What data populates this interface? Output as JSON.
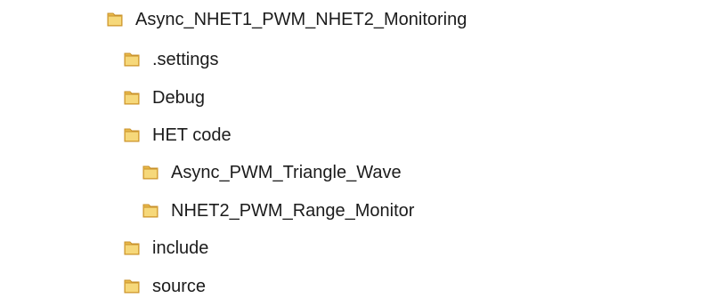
{
  "tree": {
    "root": {
      "label": "Async_NHET1_PWM_NHET2_Monitoring",
      "icon": "folder-icon"
    },
    "children": [
      {
        "label": ".settings",
        "icon": "folder-icon"
      },
      {
        "label": "Debug",
        "icon": "folder-icon"
      },
      {
        "label": "HET code",
        "icon": "folder-icon"
      },
      {
        "label": "Async_PWM_Triangle_Wave",
        "icon": "folder-icon"
      },
      {
        "label": "NHET2_PWM_Range_Monitor",
        "icon": "folder-icon"
      },
      {
        "label": "include",
        "icon": "folder-icon"
      },
      {
        "label": "source",
        "icon": "folder-icon"
      }
    ]
  },
  "colors": {
    "folder_light": "#f6d87a",
    "folder_mid": "#e9b94a",
    "folder_dark": "#c8912a",
    "text": "#1b1b1b",
    "background": "#ffffff"
  }
}
